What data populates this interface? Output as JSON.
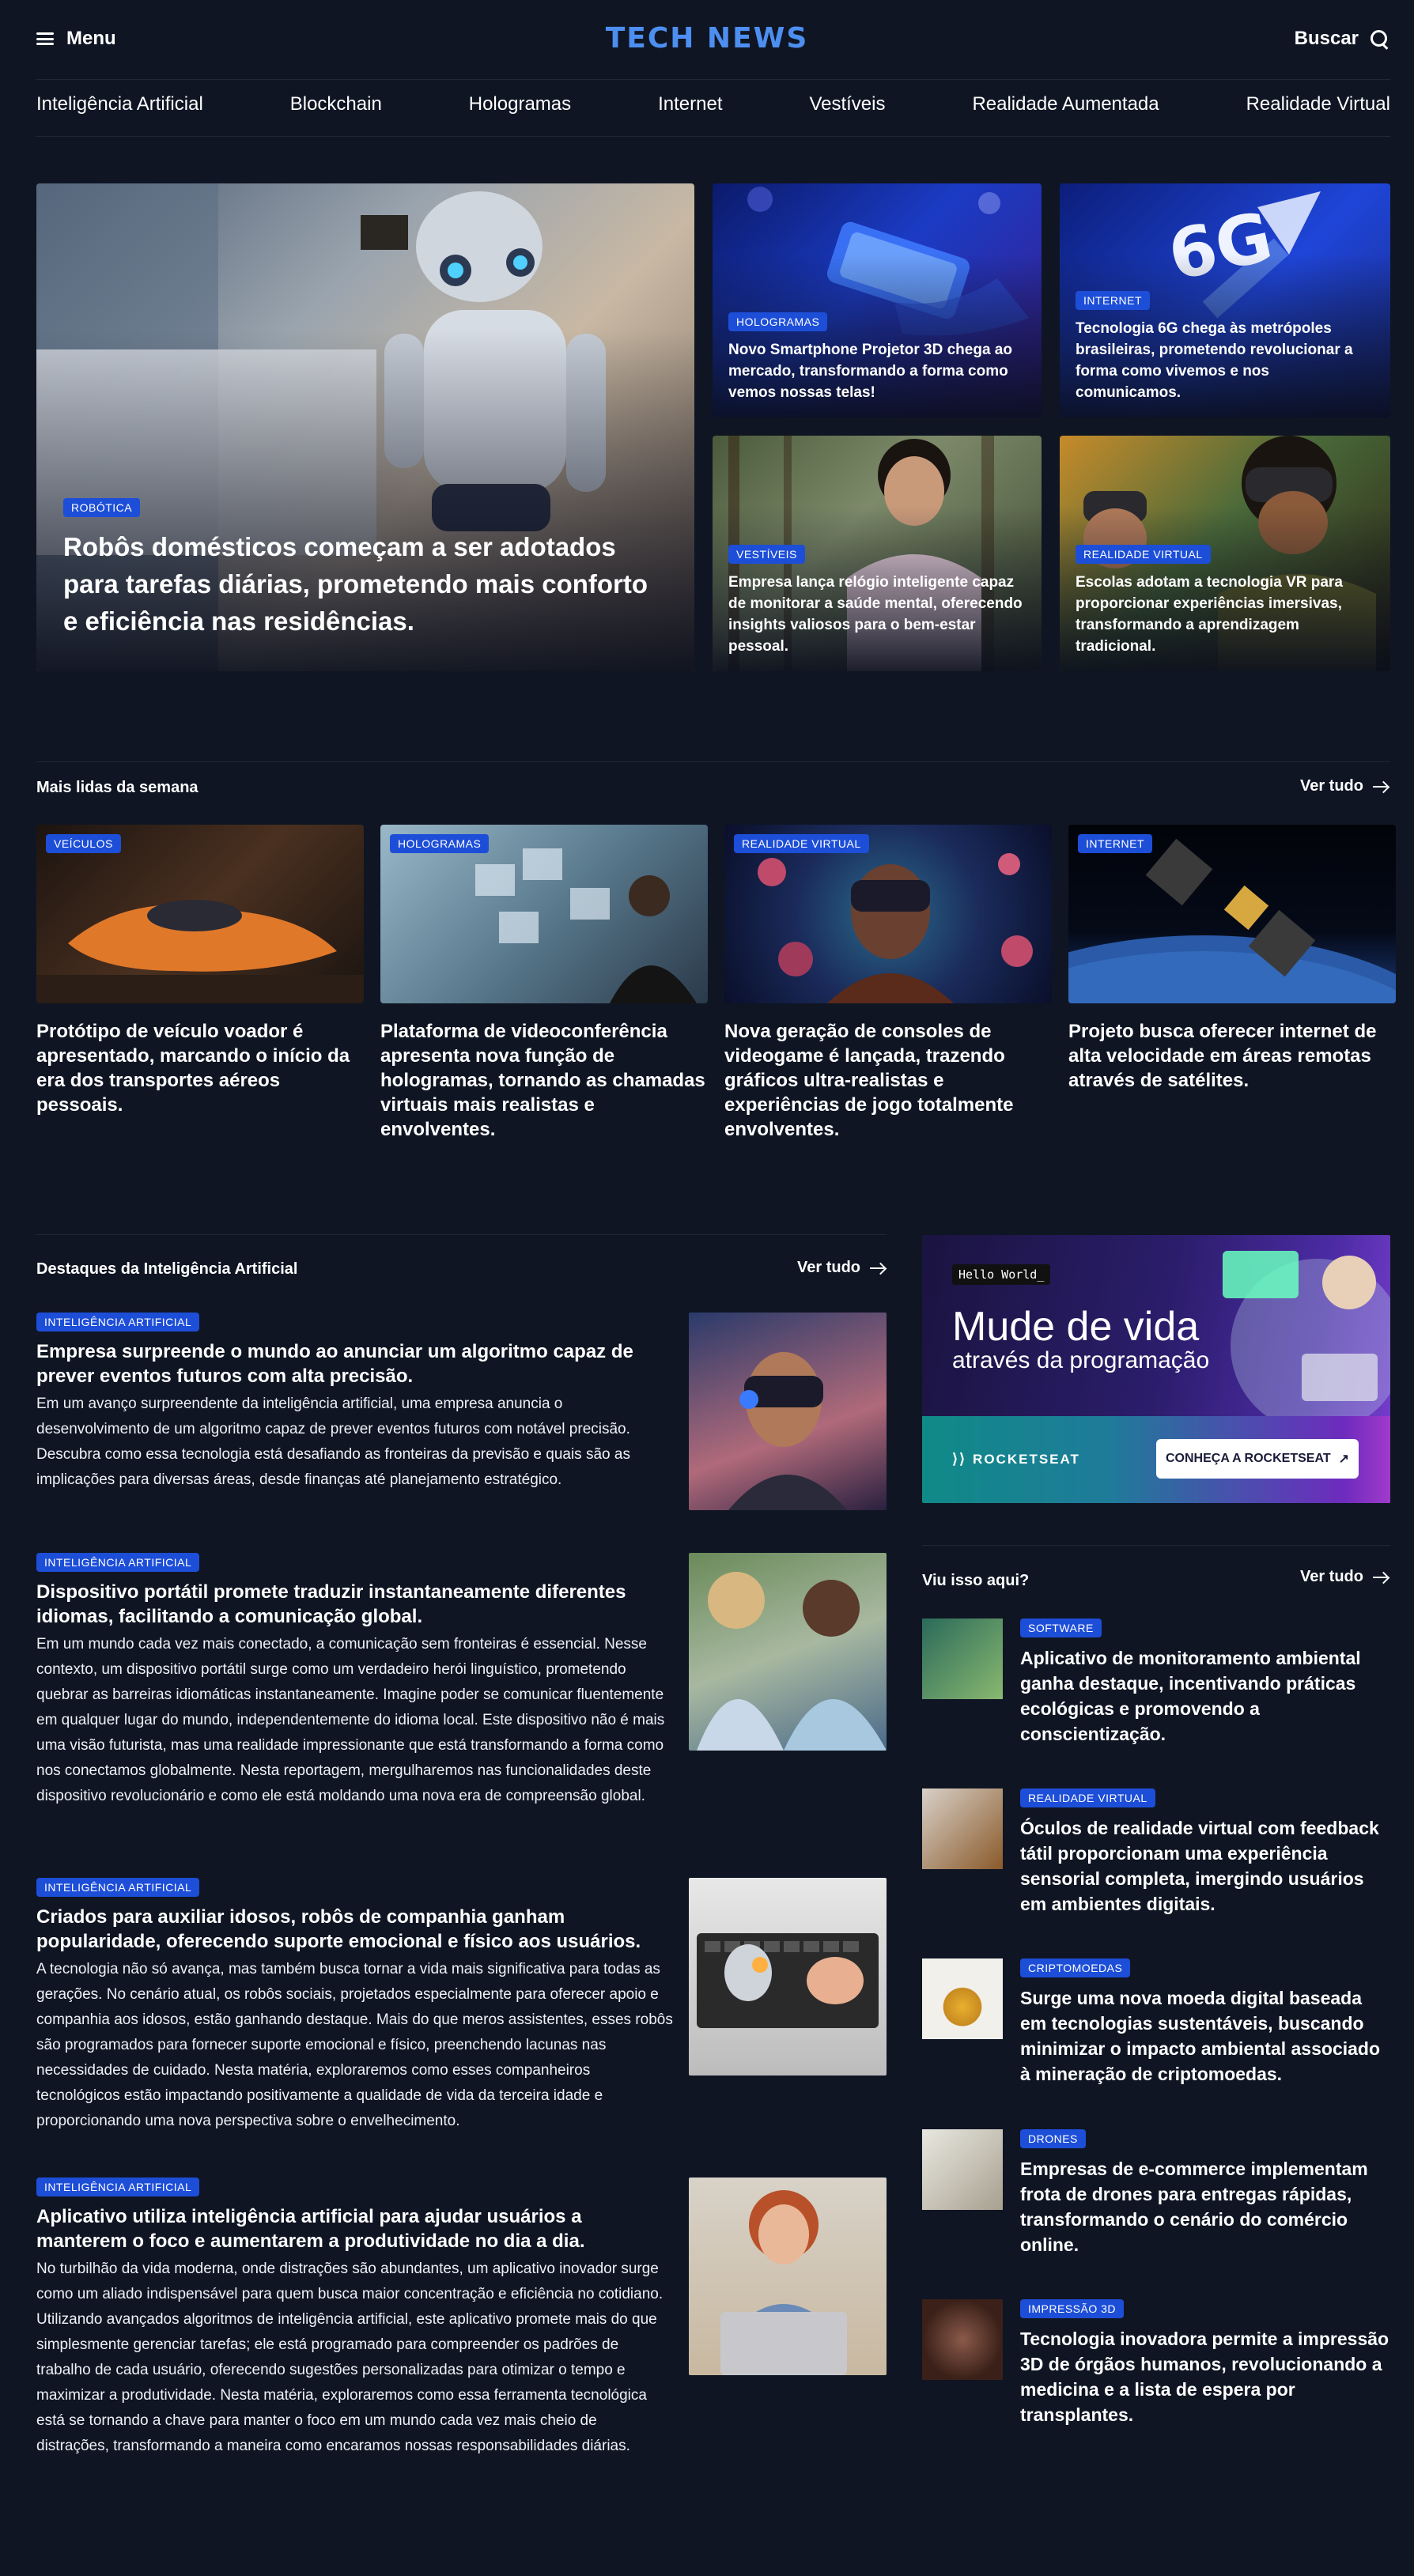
{
  "header": {
    "menu_label": "Menu",
    "logo": "TECH NEWS",
    "search_label": "Buscar"
  },
  "nav": [
    "Inteligência Artificial",
    "Blockchain",
    "Hologramas",
    "Internet",
    "Vestíveis",
    "Realidade Aumentada",
    "Realidade Virtual"
  ],
  "hero": {
    "main": {
      "tag": "ROBÓTICA",
      "title": "Robôs domésticos começam a ser adotados para tarefas diárias, prometendo mais conforto e eficiência nas residências."
    },
    "cards": [
      {
        "tag": "HOLOGRAMAS",
        "title": "Novo Smartphone Projetor 3D chega ao mercado, transformando a forma como vemos nossas telas!"
      },
      {
        "tag": "INTERNET",
        "title": "Tecnologia 6G chega às metrópoles brasileiras, prometendo revolucionar a forma como vivemos e nos comunicamos."
      },
      {
        "tag": "VESTÍVEIS",
        "title": "Empresa lança relógio inteligente capaz de monitorar a saúde mental, oferecendo insights valiosos para o bem-estar pessoal."
      },
      {
        "tag": "REALIDADE VIRTUAL",
        "title": "Escolas adotam a tecnologia VR para proporcionar experiências imersivas, transformando a aprendizagem tradicional."
      }
    ],
    "card_6g_text": "6G"
  },
  "most_read": {
    "title": "Mais lidas da semana",
    "see_all": "Ver tudo",
    "items": [
      {
        "tag": "VEÍCULOS",
        "title": "Protótipo de veículo voador é apresentado, marcando o início da era dos transportes aéreos pessoais."
      },
      {
        "tag": "HOLOGRAMAS",
        "title": "Plataforma de videoconferência apresenta nova função de hologramas, tornando as chamadas virtuais mais realistas e envolventes."
      },
      {
        "tag": "REALIDADE VIRTUAL",
        "title": "Nova geração de consoles de videogame é lançada, trazendo gráficos ultra-realistas e experiências de jogo totalmente envolventes."
      },
      {
        "tag": "INTERNET",
        "title": "Projeto busca oferecer internet de alta velocidade em áreas remotas através de satélites."
      }
    ]
  },
  "ai_highlights": {
    "title": "Destaques da Inteligência Artificial",
    "see_all": "Ver tudo",
    "articles": [
      {
        "tag": "INTELIGÊNCIA ARTIFICIAL",
        "title": "Empresa surpreende o mundo ao anunciar um algoritmo capaz de prever eventos futuros com alta precisão.",
        "text": "Em um avanço surpreendente da inteligência artificial, uma empresa anuncia o desenvolvimento de um algoritmo capaz de prever eventos futuros com notável precisão. Descubra como essa tecnologia está desafiando as fronteiras da previsão e quais são as implicações para diversas áreas, desde finanças até planejamento estratégico."
      },
      {
        "tag": "INTELIGÊNCIA ARTIFICIAL",
        "title": "Dispositivo portátil promete traduzir instantaneamente diferentes idiomas, facilitando a comunicação global.",
        "text": "Em um mundo cada vez mais conectado, a comunicação sem fronteiras é essencial. Nesse contexto, um dispositivo portátil surge como um verdadeiro herói linguístico, prometendo quebrar as barreiras idiomáticas instantaneamente. Imagine poder se comunicar fluentemente em qualquer lugar do mundo, independentemente do idioma local. Este dispositivo não é mais uma visão futurista, mas uma realidade impressionante que está transformando a forma como nos conectamos globalmente. Nesta reportagem, mergulharemos nas funcionalidades deste dispositivo revolucionário e como ele está moldando uma nova era de compreensão global."
      },
      {
        "tag": "INTELIGÊNCIA ARTIFICIAL",
        "title": "Criados para auxiliar idosos, robôs de companhia ganham popularidade, oferecendo suporte emocional e físico aos usuários.",
        "text": "A tecnologia não só avança, mas também busca tornar a vida mais significativa para todas as gerações. No cenário atual, os robôs sociais, projetados especialmente para oferecer apoio e companhia aos idosos, estão ganhando destaque. Mais do que meros assistentes, esses robôs são programados para fornecer suporte emocional e físico, preenchendo lacunas nas necessidades de cuidado. Nesta matéria, exploraremos como esses companheiros tecnológicos estão impactando positivamente a qualidade de vida da terceira idade e proporcionando uma nova perspectiva sobre o envelhecimento."
      },
      {
        "tag": "INTELIGÊNCIA ARTIFICIAL",
        "title": "Aplicativo utiliza inteligência artificial para ajudar usuários a manterem o foco e aumentarem a produtividade no dia a dia.",
        "text": "No turbilhão da vida moderna, onde distrações são abundantes, um aplicativo inovador surge como um aliado indispensável para quem busca maior concentração e eficiência no cotidiano. Utilizando avançados algoritmos de inteligência artificial, este aplicativo promete mais do que simplesmente gerenciar tarefas; ele está programado para compreender os padrões de trabalho de cada usuário, oferecendo sugestões personalizadas para otimizar o tempo e maximizar a produtividade. Nesta matéria, exploraremos como essa ferramenta tecnológica está se tornando a chave para manter o foco em um mundo cada vez mais cheio de distrações, transformando a maneira como encaramos nossas responsabilidades diárias."
      }
    ]
  },
  "ad": {
    "hello": "Hello World_",
    "headline": "Mude de vida",
    "subheadline": "através da programação",
    "brand": "ROCKETSEAT",
    "cta": "CONHEÇA A ROCKETSEAT"
  },
  "seen_here": {
    "title": "Viu isso aqui?",
    "see_all": "Ver tudo",
    "items": [
      {
        "tag": "SOFTWARE",
        "title": "Aplicativo de monitoramento ambiental ganha destaque, incentivando práticas ecológicas e promovendo a conscientização."
      },
      {
        "tag": "REALIDADE VIRTUAL",
        "title": "Óculos de realidade virtual com feedback tátil proporcionam uma experiência sensorial completa, imergindo usuários em ambientes digitais."
      },
      {
        "tag": "CRIPTOMOEDAS",
        "title": "Surge uma nova moeda digital baseada em tecnologias sustentáveis, buscando minimizar o impacto ambiental associado à mineração de criptomoedas."
      },
      {
        "tag": "DRONES",
        "title": "Empresas de e-commerce implementam frota de drones para entregas rápidas, transformando o cenário do comércio online."
      },
      {
        "tag": "IMPRESSÃO 3D",
        "title": "Tecnologia inovadora permite a impressão 3D de órgãos humanos, revolucionando a medicina e a lista de espera por transplantes."
      }
    ]
  }
}
